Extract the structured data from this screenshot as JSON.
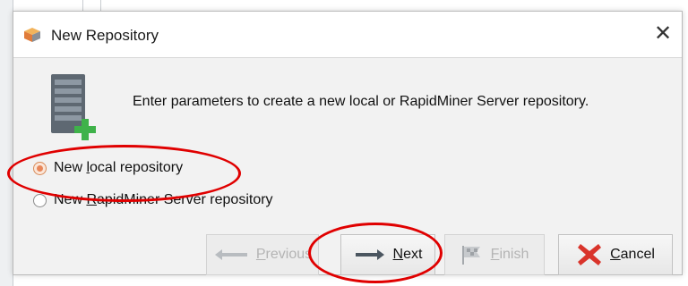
{
  "dialog": {
    "title": "New Repository",
    "close_glyph": "✕",
    "description": "Enter parameters to create a new local or RapidMiner Server repository.",
    "icons": {
      "title": "repository-cube-icon",
      "main": "repository-add-icon",
      "prev": "arrow-left-icon",
      "next": "arrow-right-icon",
      "finish": "finish-flag-icon",
      "cancel": "cancel-x-icon"
    }
  },
  "options": [
    {
      "pre": "New ",
      "mnemonic": "l",
      "post": "ocal repository",
      "selected": true
    },
    {
      "pre": "New ",
      "mnemonic": "R",
      "post": "apidMiner Server repository",
      "selected": false
    }
  ],
  "buttons": {
    "previous": {
      "mnemonic": "P",
      "rest": "revious",
      "enabled": false
    },
    "next": {
      "mnemonic": "N",
      "rest": "ext",
      "enabled": true
    },
    "finish": {
      "mnemonic": "F",
      "rest": "inish",
      "enabled": false
    },
    "cancel": {
      "mnemonic": "C",
      "rest": "ancel",
      "enabled": true
    }
  },
  "colors": {
    "annotation": "#e00000",
    "radio_selected": "#e8875a",
    "cancel_x": "#d9342b",
    "plus_green": "#3fb24a"
  }
}
